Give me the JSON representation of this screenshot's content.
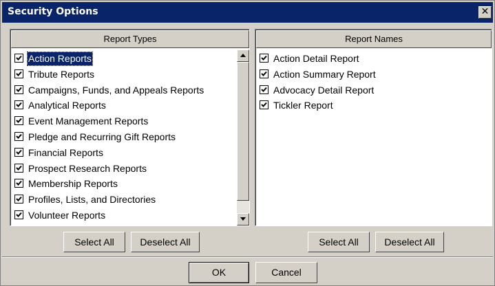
{
  "window": {
    "title": "Security Options",
    "close_label": "✕"
  },
  "report_types": {
    "header": "Report Types",
    "items": [
      {
        "label": "Action Reports",
        "checked": true,
        "selected": true
      },
      {
        "label": "Tribute Reports",
        "checked": true
      },
      {
        "label": "Campaigns, Funds, and Appeals Reports",
        "checked": true
      },
      {
        "label": "Analytical Reports",
        "checked": true
      },
      {
        "label": "Event Management Reports",
        "checked": true
      },
      {
        "label": "Pledge and Recurring Gift Reports",
        "checked": true
      },
      {
        "label": "Financial Reports",
        "checked": true
      },
      {
        "label": "Prospect Research Reports",
        "checked": true
      },
      {
        "label": "Membership Reports",
        "checked": true
      },
      {
        "label": "Profiles, Lists, and Directories",
        "checked": true
      },
      {
        "label": "Volunteer Reports",
        "checked": true
      }
    ],
    "select_all": "Select All",
    "deselect_all": "Deselect All"
  },
  "report_names": {
    "header": "Report Names",
    "items": [
      {
        "label": "Action Detail Report",
        "checked": true
      },
      {
        "label": "Action Summary Report",
        "checked": true
      },
      {
        "label": "Advocacy Detail Report",
        "checked": true
      },
      {
        "label": "Tickler Report",
        "checked": true
      }
    ],
    "select_all": "Select All",
    "deselect_all": "Deselect All"
  },
  "footer": {
    "ok": "OK",
    "cancel": "Cancel"
  },
  "colors": {
    "titlebar": "#0a246a",
    "face": "#d4d0c8",
    "selection": "#0a246a"
  }
}
